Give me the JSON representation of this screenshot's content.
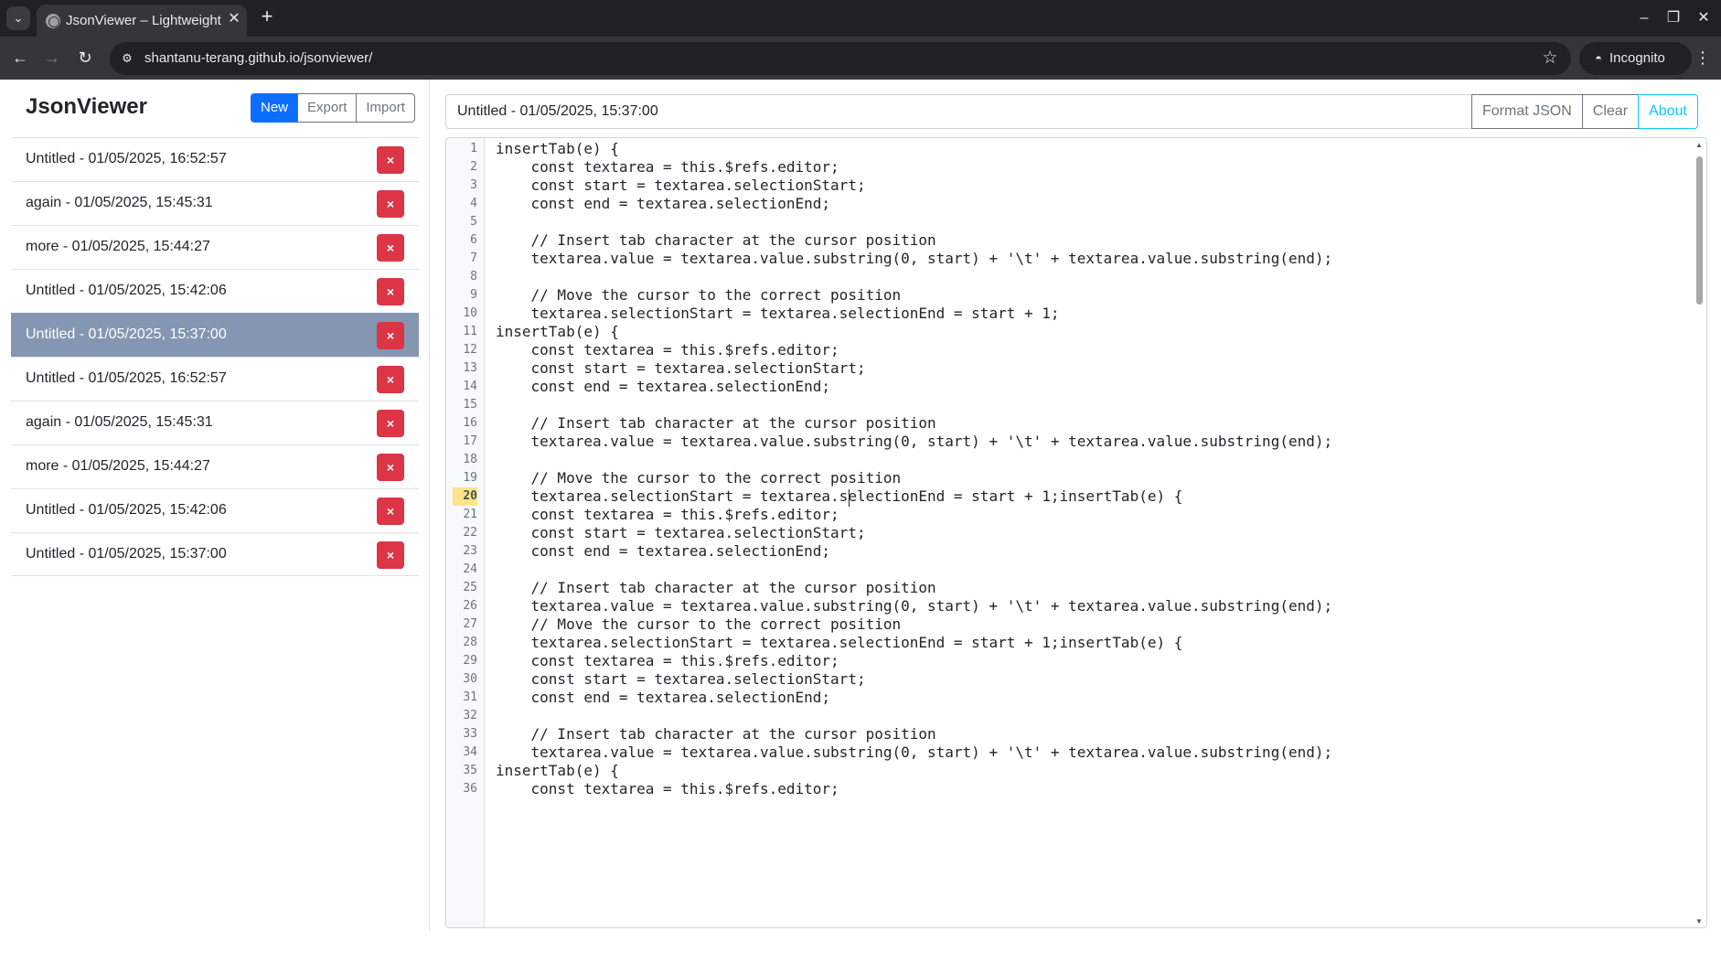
{
  "browser": {
    "tab_title": "JsonViewer – Lightweight JSON Viewer",
    "url": "shantanu-terang.github.io/jsonviewer/",
    "incognito_label": "Incognito",
    "icons": [
      "tab-search-icon",
      "globe-icon",
      "close-icon",
      "plus-icon",
      "back-icon",
      "forward-icon",
      "reload-icon",
      "site-info-icon",
      "star-icon",
      "incognito-icon",
      "kebab-menu-icon",
      "minimize-icon",
      "restore-icon",
      "window-close-icon"
    ]
  },
  "sidebar": {
    "brand": "JsonViewer",
    "buttons": {
      "new": "New",
      "export": "Export",
      "import": "Import"
    },
    "delete_glyph": "×",
    "documents": [
      {
        "name": "Untitled - 01/05/2025, 16:52:57",
        "active": false
      },
      {
        "name": "again - 01/05/2025, 15:45:31",
        "active": false
      },
      {
        "name": "more - 01/05/2025, 15:44:27",
        "active": false
      },
      {
        "name": "Untitled - 01/05/2025, 15:42:06",
        "active": false
      },
      {
        "name": "Untitled - 01/05/2025, 15:37:00",
        "active": true
      },
      {
        "name": "Untitled - 01/05/2025, 16:52:57",
        "active": false
      },
      {
        "name": "again - 01/05/2025, 15:45:31",
        "active": false
      },
      {
        "name": "more - 01/05/2025, 15:44:27",
        "active": false
      },
      {
        "name": "Untitled - 01/05/2025, 15:42:06",
        "active": false
      },
      {
        "name": "Untitled - 01/05/2025, 15:37:00",
        "active": false
      }
    ]
  },
  "main": {
    "title_value": "Untitled - 01/05/2025, 15:37:00",
    "buttons": {
      "format": "Format JSON",
      "clear": "Clear",
      "about": "About"
    }
  },
  "editor": {
    "current_line": 20,
    "lines": [
      "insertTab(e) {",
      "    const textarea = this.$refs.editor;",
      "    const start = textarea.selectionStart;",
      "    const end = textarea.selectionEnd;",
      "",
      "    // Insert tab character at the cursor position",
      "    textarea.value = textarea.value.substring(0, start) + '\\t' + textarea.value.substring(end);",
      "",
      "    // Move the cursor to the correct position",
      "    textarea.selectionStart = textarea.selectionEnd = start + 1;",
      "insertTab(e) {",
      "    const textarea = this.$refs.editor;",
      "    const start = textarea.selectionStart;",
      "    const end = textarea.selectionEnd;",
      "",
      "    // Insert tab character at the cursor position",
      "    textarea.value = textarea.value.substring(0, start) + '\\t' + textarea.value.substring(end);",
      "",
      "    // Move the cursor to the correct position",
      "    textarea.selectionStart = textarea.selectionEnd = start + 1;insertTab(e) {",
      "    const textarea = this.$refs.editor;",
      "    const start = textarea.selectionStart;",
      "    const end = textarea.selectionEnd;",
      "",
      "    // Insert tab character at the cursor position",
      "    textarea.value = textarea.value.substring(0, start) + '\\t' + textarea.value.substring(end);",
      "    // Move the cursor to the correct position",
      "    textarea.selectionStart = textarea.selectionEnd = start + 1;insertTab(e) {",
      "    const textarea = this.$refs.editor;",
      "    const start = textarea.selectionStart;",
      "    const end = textarea.selectionEnd;",
      "",
      "    // Insert tab character at the cursor position",
      "    textarea.value = textarea.value.substring(0, start) + '\\t' + textarea.value.substring(end);",
      "insertTab(e) {",
      "    const textarea = this.$refs.editor;"
    ]
  }
}
